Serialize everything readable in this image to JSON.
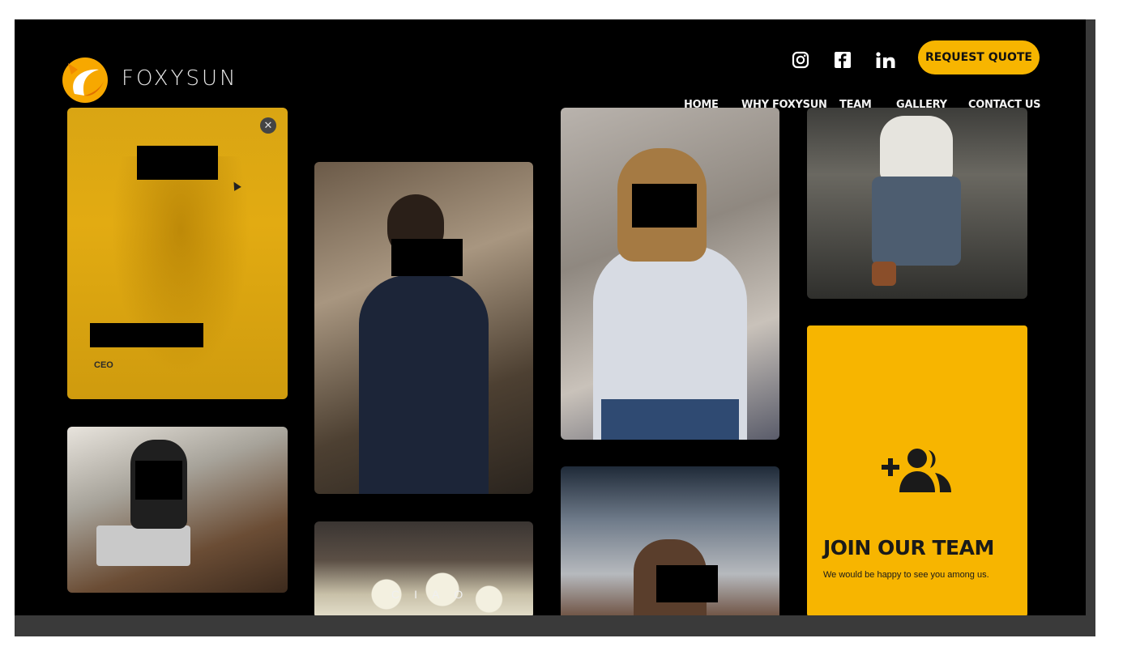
{
  "brand": {
    "name": "FOXYSUN",
    "accent": "#f7b500"
  },
  "header": {
    "social": [
      {
        "name": "instagram-icon",
        "glyph": "◎"
      },
      {
        "name": "facebook-icon",
        "glyph": "f"
      },
      {
        "name": "linkedin-icon",
        "glyph": "in"
      }
    ],
    "quote_button": "REQUEST QUOTE"
  },
  "nav": [
    "HOME",
    "WHY FOXYSUN",
    "TEAM",
    "GALLERY",
    "CONTACT US"
  ],
  "team": {
    "ceo_role": "CEO",
    "close_glyph": "✕",
    "ciao_text": "CIAO"
  },
  "join": {
    "title": "JOIN OUR TEAM",
    "text": "We would be happy to see you among us."
  }
}
